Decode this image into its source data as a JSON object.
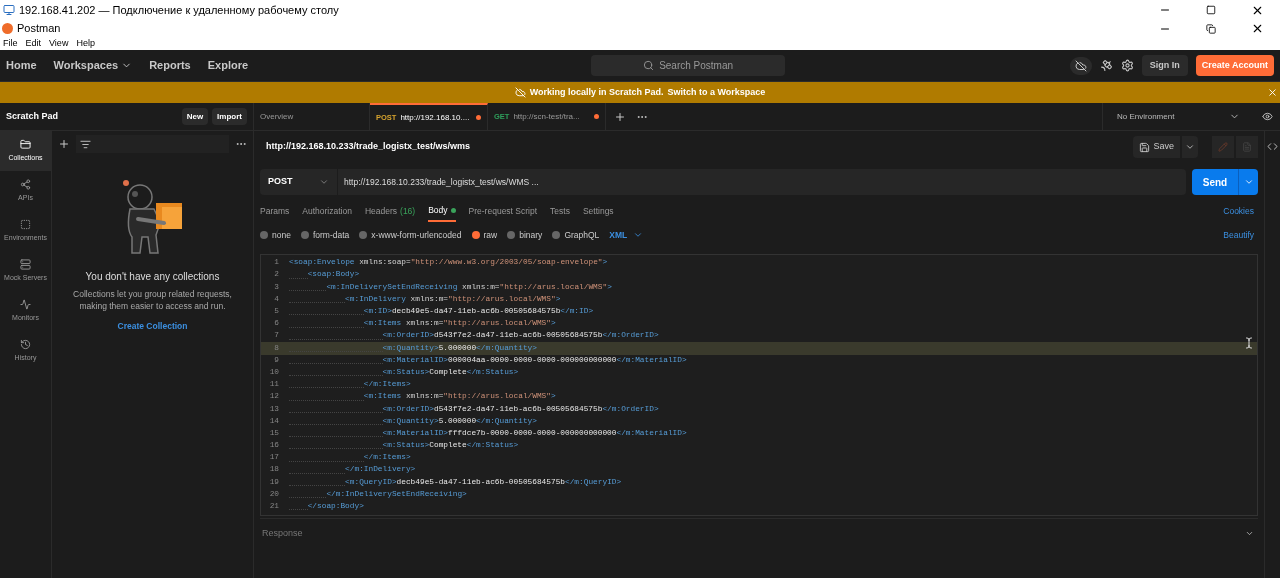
{
  "remote_title": "192.168.41.202 — Подключение к удаленному рабочему столу",
  "app": {
    "title": "Postman",
    "menu": [
      "File",
      "Edit",
      "View",
      "Help"
    ]
  },
  "nav": {
    "items": [
      {
        "label": "Home",
        "dropdown": false
      },
      {
        "label": "Workspaces",
        "dropdown": true
      },
      {
        "label": "Reports",
        "dropdown": false
      },
      {
        "label": "Explore",
        "dropdown": false
      }
    ],
    "search_placeholder": "Search Postman",
    "sign_in": "Sign In",
    "create_account": "Create Account"
  },
  "banner": {
    "text": "Working locally in Scratch Pad.",
    "link": "Switch to a Workspace"
  },
  "sidebar": {
    "title": "Scratch Pad",
    "buttons": [
      "New",
      "Import"
    ],
    "rail": [
      {
        "kind": "collections",
        "label": "Collections",
        "selected": true
      },
      {
        "kind": "apis",
        "label": "APIs",
        "selected": false
      },
      {
        "kind": "environments",
        "label": "Environments",
        "selected": false
      },
      {
        "kind": "mock",
        "label": "Mock Servers",
        "selected": false
      },
      {
        "kind": "monitors",
        "label": "Monitors",
        "selected": false
      },
      {
        "kind": "history",
        "label": "History",
        "selected": false
      }
    ],
    "empty": {
      "title": "You don't have any collections",
      "text": "Collections let you group related requests, making them easier to access and run.",
      "action": "Create Collection"
    }
  },
  "tabs": [
    {
      "kind": "plain",
      "label": "Overview",
      "selected": false
    },
    {
      "kind": "request",
      "method": "POST",
      "color": "#d6a32e",
      "label": "http://192.168.10....",
      "unsaved": true,
      "selected": true
    },
    {
      "kind": "request",
      "method": "GET",
      "color": "#2e9e5b",
      "label": "http://scn-test/tra...",
      "unsaved": true,
      "selected": false
    }
  ],
  "environment": "No Environment",
  "request": {
    "title": "http://192.168.10.233/trade_logistx_test/ws/wms",
    "save": "Save",
    "method": "POST",
    "url": "http://192.168.10.233/trade_logistx_test/ws/WMS ...",
    "send": "Send",
    "tabs": [
      {
        "label": "Params",
        "selected": false
      },
      {
        "label": "Authorization",
        "selected": false
      },
      {
        "label": "Headers",
        "count": "(16)",
        "selected": false
      },
      {
        "label": "Body",
        "dot": true,
        "selected": true
      },
      {
        "label": "Pre-request Script",
        "selected": false
      },
      {
        "label": "Tests",
        "selected": false
      },
      {
        "label": "Settings",
        "selected": false
      }
    ],
    "cookies": "Cookies",
    "body_types": [
      {
        "label": "none",
        "selected": false
      },
      {
        "label": "form-data",
        "selected": false
      },
      {
        "label": "x-www-form-urlencoded",
        "selected": false
      },
      {
        "label": "raw",
        "selected": true
      },
      {
        "label": "binary",
        "selected": false
      },
      {
        "label": "GraphQL",
        "selected": false
      }
    ],
    "language": "XML",
    "beautify": "Beautify",
    "code": [
      {
        "num": "1",
        "selected": false,
        "tokens": [
          {
            "kind": "tag",
            "text": "<soap:Envelope"
          },
          {
            "kind": "attr",
            "text": " xmlns:soap="
          },
          {
            "kind": "string",
            "text": "\"http://www.w3.org/2003/05/soap-envelope\""
          },
          {
            "kind": "tag",
            "text": ">"
          }
        ],
        "children": [
          {
            "num": "2",
            "selected": false,
            "tokens": [
              {
                "kind": "tag",
                "text": "<soap:Body>"
              }
            ],
            "children": [
              {
                "num": "3",
                "selected": false,
                "tokens": [
                  {
                    "kind": "tag",
                    "text": "<m:InDeliverySetEndReceiving"
                  },
                  {
                    "kind": "attr",
                    "text": " xmlns:m="
                  },
                  {
                    "kind": "string",
                    "text": "\"http://arus.local/WMS\""
                  },
                  {
                    "kind": "tag",
                    "text": ">"
                  }
                ],
                "children": [
                  {
                    "num": "4",
                    "selected": false,
                    "tokens": [
                      {
                        "kind": "tag",
                        "text": "<m:InDelivery"
                      },
                      {
                        "kind": "attr",
                        "text": " xmlns:m="
                      },
                      {
                        "kind": "string",
                        "text": "\"http://arus.local/WMS\""
                      },
                      {
                        "kind": "tag",
                        "text": ">"
                      }
                    ],
                    "children": [
                      {
                        "num": "5",
                        "selected": false,
                        "tokens": [
                          {
                            "kind": "tag",
                            "text": "<m:ID>"
                          },
                          {
                            "kind": "text",
                            "text": "decb49e5-da47-11eb-ac6b-00505684575b"
                          },
                          {
                            "kind": "tag",
                            "text": "</m:ID>"
                          }
                        ]
                      },
                      {
                        "num": "6",
                        "selected": false,
                        "tokens": [
                          {
                            "kind": "tag",
                            "text": "<m:Items"
                          },
                          {
                            "kind": "attr",
                            "text": " xmlns:m="
                          },
                          {
                            "kind": "string",
                            "text": "\"http://arus.local/WMS\""
                          },
                          {
                            "kind": "tag",
                            "text": ">"
                          }
                        ],
                        "children": [
                          {
                            "num": "7",
                            "selected": false,
                            "tokens": [
                              {
                                "kind": "tag",
                                "text": "<m:OrderID>"
                              },
                              {
                                "kind": "text",
                                "text": "d543f7e2-da47-11eb-ac6b-00505684575b"
                              },
                              {
                                "kind": "tag",
                                "text": "</m:OrderID>"
                              }
                            ]
                          },
                          {
                            "num": "8",
                            "selected": true,
                            "tokens": [
                              {
                                "kind": "tag",
                                "text": "<m:Quantity>"
                              },
                              {
                                "kind": "text",
                                "text": "5.000000"
                              },
                              {
                                "kind": "tag",
                                "text": "</m:Quantity>"
                              }
                            ]
                          },
                          {
                            "num": "9",
                            "selected": false,
                            "tokens": [
                              {
                                "kind": "tag",
                                "text": "<m:MaterialID>"
                              },
                              {
                                "kind": "text",
                                "text": "000004aa-0000-0000-0000-000000000000"
                              },
                              {
                                "kind": "tag",
                                "text": "</m:MaterialID>"
                              }
                            ]
                          },
                          {
                            "num": "10",
                            "selected": false,
                            "tokens": [
                              {
                                "kind": "tag",
                                "text": "<m:Status>"
                              },
                              {
                                "kind": "text",
                                "text": "Complete"
                              },
                              {
                                "kind": "tag",
                                "text": "</m:Status>"
                              }
                            ]
                          }
                        ]
                      },
                      {
                        "num": "11",
                        "selected": false,
                        "tokens": [
                          {
                            "kind": "tag",
                            "text": "</m:Items>"
                          }
                        ]
                      },
                      {
                        "num": "12",
                        "selected": false,
                        "tokens": [
                          {
                            "kind": "tag",
                            "text": "<m:Items"
                          },
                          {
                            "kind": "attr",
                            "text": " xmlns:m="
                          },
                          {
                            "kind": "string",
                            "text": "\"http://arus.local/WMS\""
                          },
                          {
                            "kind": "tag",
                            "text": ">"
                          }
                        ],
                        "children": [
                          {
                            "num": "13",
                            "selected": false,
                            "tokens": [
                              {
                                "kind": "tag",
                                "text": "<m:OrderID>"
                              },
                              {
                                "kind": "text",
                                "text": "d543f7e2-da47-11eb-ac6b-00505684575b"
                              },
                              {
                                "kind": "tag",
                                "text": "</m:OrderID>"
                              }
                            ]
                          },
                          {
                            "num": "14",
                            "selected": false,
                            "tokens": [
                              {
                                "kind": "tag",
                                "text": "<m:Quantity>"
                              },
                              {
                                "kind": "text",
                                "text": "5.000000"
                              },
                              {
                                "kind": "tag",
                                "text": "</m:Quantity>"
                              }
                            ]
                          },
                          {
                            "num": "15",
                            "selected": false,
                            "tokens": [
                              {
                                "kind": "tag",
                                "text": "<m:MaterialID>"
                              },
                              {
                                "kind": "text",
                                "text": "fffdce7b-0000-0000-0000-000000000000"
                              },
                              {
                                "kind": "tag",
                                "text": "</m:MaterialID>"
                              }
                            ]
                          },
                          {
                            "num": "16",
                            "selected": false,
                            "tokens": [
                              {
                                "kind": "tag",
                                "text": "<m:Status>"
                              },
                              {
                                "kind": "text",
                                "text": "Complete"
                              },
                              {
                                "kind": "tag",
                                "text": "</m:Status>"
                              }
                            ]
                          }
                        ]
                      },
                      {
                        "num": "17",
                        "selected": false,
                        "tokens": [
                          {
                            "kind": "tag",
                            "text": "</m:Items>"
                          }
                        ]
                      }
                    ]
                  },
                  {
                    "num": "18",
                    "selected": false,
                    "tokens": [
                      {
                        "kind": "tag",
                        "text": "</m:InDelivery>"
                      }
                    ]
                  },
                  {
                    "num": "19",
                    "selected": false,
                    "tokens": [
                      {
                        "kind": "tag",
                        "text": "<m:QueryID>"
                      },
                      {
                        "kind": "text",
                        "text": "decb49e5-da47-11eb-ac6b-00505684575b"
                      },
                      {
                        "kind": "tag",
                        "text": "</m:QueryID>"
                      }
                    ]
                  }
                ]
              },
              {
                "num": "20",
                "selected": false,
                "tokens": [
                  {
                    "kind": "tag",
                    "text": "</m:InDeliverySetEndReceiving>"
                  }
                ]
              }
            ]
          },
          {
            "num": "21",
            "selected": false,
            "tokens": [
              {
                "kind": "tag",
                "text": "</soap:Body>"
              }
            ]
          }
        ]
      }
    ]
  },
  "response": {
    "title": "Response"
  }
}
